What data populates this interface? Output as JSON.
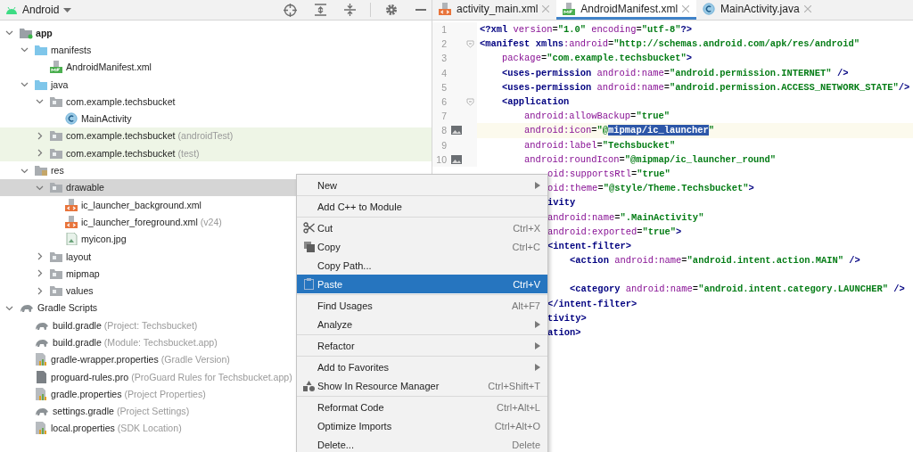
{
  "project_view": {
    "title": "Android"
  },
  "tree": [
    {
      "label": "app",
      "kind": "module",
      "expanded": true,
      "selected": false,
      "test_scope": false,
      "children": [
        {
          "label": "manifests",
          "kind": "folder",
          "expanded": true,
          "selected": false,
          "test_scope": false,
          "children": [
            {
              "label": "AndroidManifest.xml",
              "kind": "manifest",
              "selected": false,
              "test_scope": false
            }
          ]
        },
        {
          "label": "java",
          "kind": "folder",
          "expanded": true,
          "selected": false,
          "test_scope": false,
          "children": [
            {
              "label": "com.example.techsbucket",
              "kind": "package",
              "expanded": true,
              "selected": false,
              "test_scope": false,
              "children": [
                {
                  "label": "MainActivity",
                  "kind": "class",
                  "selected": false,
                  "test_scope": false
                }
              ]
            },
            {
              "label": "com.example.techsbucket",
              "note": "(androidTest)",
              "kind": "package",
              "expanded": false,
              "selected": false,
              "test_scope": true
            },
            {
              "label": "com.example.techsbucket",
              "note": "(test)",
              "kind": "package",
              "expanded": false,
              "selected": false,
              "test_scope": true
            }
          ]
        },
        {
          "label": "res",
          "kind": "res",
          "expanded": true,
          "selected": false,
          "test_scope": false,
          "children": [
            {
              "label": "drawable",
              "kind": "package",
              "expanded": true,
              "selected": true,
              "test_scope": false,
              "children": [
                {
                  "label": "ic_launcher_background.xml",
                  "kind": "xml",
                  "selected": false,
                  "test_scope": false
                },
                {
                  "label": "ic_launcher_foreground.xml",
                  "note": "(v24)",
                  "kind": "xml",
                  "selected": false,
                  "test_scope": false
                },
                {
                  "label": "myicon.jpg",
                  "kind": "image",
                  "selected": false,
                  "test_scope": false
                }
              ]
            },
            {
              "label": "layout",
              "kind": "package",
              "expanded": false,
              "selected": false,
              "test_scope": false
            },
            {
              "label": "mipmap",
              "kind": "package",
              "expanded": false,
              "selected": false,
              "test_scope": false
            },
            {
              "label": "values",
              "kind": "package",
              "expanded": false,
              "selected": false,
              "test_scope": false
            }
          ]
        }
      ]
    },
    {
      "label": "Gradle Scripts",
      "kind": "gradle",
      "expanded": true,
      "selected": false,
      "test_scope": false,
      "children": [
        {
          "label": "build.gradle",
          "note": "(Project: Techsbucket)",
          "kind": "gradle",
          "selected": false,
          "test_scope": false
        },
        {
          "label": "build.gradle",
          "note": "(Module: Techsbucket.app)",
          "kind": "gradle",
          "selected": false,
          "test_scope": false
        },
        {
          "label": "gradle-wrapper.properties",
          "note": "(Gradle Version)",
          "kind": "properties",
          "selected": false,
          "test_scope": false
        },
        {
          "label": "proguard-rules.pro",
          "note": "(ProGuard Rules for Techsbucket.app)",
          "kind": "proguard",
          "selected": false,
          "test_scope": false
        },
        {
          "label": "gradle.properties",
          "note": "(Project Properties)",
          "kind": "properties",
          "selected": false,
          "test_scope": false
        },
        {
          "label": "settings.gradle",
          "note": "(Project Settings)",
          "kind": "gradle",
          "selected": false,
          "test_scope": false
        },
        {
          "label": "local.properties",
          "note": "(SDK Location)",
          "kind": "properties",
          "selected": false,
          "test_scope": false
        }
      ]
    }
  ],
  "tabs": [
    {
      "label": "activity_main.xml",
      "kind": "xml",
      "selected": false
    },
    {
      "label": "AndroidManifest.xml",
      "kind": "manifest",
      "selected": true
    },
    {
      "label": "MainActivity.java",
      "kind": "class",
      "selected": false
    }
  ],
  "editor_lines": [
    {
      "kind": "code",
      "number": "1",
      "foldable": false,
      "preview": false,
      "current": false,
      "tokens": [
        {
          "kind": "tag",
          "text": "<?xml"
        },
        {
          "kind": "attr",
          "text": " version"
        },
        {
          "kind": "plain",
          "text": "="
        },
        {
          "kind": "value",
          "text": "\"1.0\""
        },
        {
          "kind": "attr",
          "text": " encoding"
        },
        {
          "kind": "plain",
          "text": "="
        },
        {
          "kind": "value",
          "text": "\"utf-8\""
        },
        {
          "kind": "tag",
          "text": "?>"
        }
      ]
    },
    {
      "kind": "code",
      "number": "2",
      "foldable": true,
      "preview": false,
      "current": false,
      "tokens": [
        {
          "kind": "tag",
          "text": "<manifest xmlns"
        },
        {
          "kind": "attr",
          "text": ":android"
        },
        {
          "kind": "plain",
          "text": "="
        },
        {
          "kind": "value",
          "text": "\"http://schemas.android.com/apk/res/android\""
        }
      ],
      "children": [
        {
          "kind": "code",
          "number": "3",
          "foldable": false,
          "preview": false,
          "current": false,
          "tokens": [
            {
              "kind": "attr",
              "text": "package"
            },
            {
              "kind": "plain",
              "text": "="
            },
            {
              "kind": "value",
              "text": "\"com.example.techsbucket\""
            },
            {
              "kind": "tag",
              "text": ">"
            }
          ]
        },
        {
          "kind": "code",
          "number": "4",
          "foldable": false,
          "preview": false,
          "current": false,
          "tokens": [
            {
              "kind": "tag",
              "text": "<uses-permission"
            },
            {
              "kind": "attr",
              "text": " android:name"
            },
            {
              "kind": "plain",
              "text": "="
            },
            {
              "kind": "value",
              "text": "\"android.permission.INTERNET\""
            },
            {
              "kind": "tag",
              "text": " />"
            }
          ]
        },
        {
          "kind": "code",
          "number": "5",
          "foldable": false,
          "preview": false,
          "current": false,
          "tokens": [
            {
              "kind": "tag",
              "text": "<uses-permission"
            },
            {
              "kind": "attr",
              "text": " android:name"
            },
            {
              "kind": "plain",
              "text": "="
            },
            {
              "kind": "value",
              "text": "\"android.permission.ACCESS_NETWORK_STATE\""
            },
            {
              "kind": "tag",
              "text": "/>"
            }
          ]
        },
        {
          "kind": "code",
          "number": "6",
          "foldable": true,
          "preview": false,
          "current": false,
          "tokens": [
            {
              "kind": "tag",
              "text": "<application"
            }
          ],
          "children": [
            {
              "kind": "code",
              "number": "7",
              "foldable": false,
              "preview": false,
              "current": false,
              "tokens": [
                {
                  "kind": "attr",
                  "text": "android:allowBackup"
                },
                {
                  "kind": "plain",
                  "text": "="
                },
                {
                  "kind": "value",
                  "text": "\"true\""
                }
              ]
            },
            {
              "kind": "code",
              "number": "8",
              "foldable": false,
              "preview": true,
              "current": true,
              "tokens": [
                {
                  "kind": "attr",
                  "text": "android:icon"
                },
                {
                  "kind": "plain",
                  "text": "="
                },
                {
                  "kind": "value",
                  "text": "\"@"
                },
                {
                  "kind": "selection",
                  "text": "mipmap/ic_launcher"
                },
                {
                  "kind": "value",
                  "text": "\""
                }
              ]
            },
            {
              "kind": "code",
              "number": "9",
              "foldable": false,
              "preview": false,
              "current": false,
              "tokens": [
                {
                  "kind": "attr",
                  "text": "android:label"
                },
                {
                  "kind": "plain",
                  "text": "="
                },
                {
                  "kind": "value",
                  "text": "\"Techsbucket\""
                }
              ]
            },
            {
              "kind": "code",
              "number": "10",
              "foldable": false,
              "preview": true,
              "current": false,
              "tokens": [
                {
                  "kind": "attr",
                  "text": "android:roundIcon"
                },
                {
                  "kind": "plain",
                  "text": "="
                },
                {
                  "kind": "value",
                  "text": "\"@mipmap/ic_launcher_round\""
                }
              ]
            }
          ]
        }
      ]
    }
  ],
  "clipped_lines": [
    {
      "kind": "code",
      "tokens": [
        {
          "kind": "attr",
          "text": "oid:supportsRtl"
        },
        {
          "kind": "plain",
          "text": "="
        },
        {
          "kind": "value",
          "text": "\"true\""
        }
      ]
    },
    {
      "kind": "code",
      "tokens": [
        {
          "kind": "attr",
          "text": "oid:theme"
        },
        {
          "kind": "plain",
          "text": "="
        },
        {
          "kind": "value",
          "text": "\"@style/Theme.Techsbucket\""
        },
        {
          "kind": "tag",
          "text": ">"
        }
      ]
    },
    {
      "kind": "code",
      "tokens": [
        {
          "kind": "tag",
          "text": "ivity"
        }
      ]
    },
    {
      "kind": "code",
      "tokens": [
        {
          "kind": "attr",
          "text": "android:name"
        },
        {
          "kind": "plain",
          "text": "="
        },
        {
          "kind": "value",
          "text": "\".MainActivity\""
        }
      ]
    },
    {
      "kind": "code",
      "tokens": [
        {
          "kind": "attr",
          "text": "android:exported"
        },
        {
          "kind": "plain",
          "text": "="
        },
        {
          "kind": "value",
          "text": "\"true\""
        },
        {
          "kind": "tag",
          "text": ">"
        }
      ]
    },
    {
      "kind": "code",
      "tokens": [
        {
          "kind": "tag",
          "text": "<intent-filter>"
        }
      ],
      "children": [
        {
          "kind": "code",
          "tokens": [
            {
              "kind": "tag",
              "text": "<action"
            },
            {
              "kind": "attr",
              "text": " android:name"
            },
            {
              "kind": "plain",
              "text": "="
            },
            {
              "kind": "value",
              "text": "\"android.intent.action.MAIN\""
            },
            {
              "kind": "tag",
              "text": " />"
            }
          ]
        },
        {
          "kind": "blank"
        },
        {
          "kind": "code",
          "tokens": [
            {
              "kind": "tag",
              "text": "<category"
            },
            {
              "kind": "attr",
              "text": " android:name"
            },
            {
              "kind": "plain",
              "text": "="
            },
            {
              "kind": "value",
              "text": "\"android.intent.category.LAUNCHER\""
            },
            {
              "kind": "tag",
              "text": " />"
            }
          ]
        }
      ]
    },
    {
      "kind": "code",
      "tokens": [
        {
          "kind": "tag",
          "text": "</intent-filter>"
        }
      ]
    },
    {
      "kind": "code",
      "tokens": [
        {
          "kind": "tag",
          "text": "tivity>"
        }
      ]
    },
    {
      "kind": "code",
      "tokens": [
        {
          "kind": "tag",
          "text": "ation>"
        }
      ]
    }
  ],
  "context_menu": {
    "groups": [
      [
        {
          "label": "New",
          "kind": "plain",
          "submenu": true,
          "selected": false
        }
      ],
      [
        {
          "label": "Add C++ to Module",
          "kind": "plain",
          "submenu": false,
          "selected": false
        }
      ],
      [
        {
          "label": "Cut",
          "kind": "scissors",
          "shortcut": "Ctrl+X",
          "submenu": false,
          "selected": false
        },
        {
          "label": "Copy",
          "kind": "copy",
          "shortcut": "Ctrl+C",
          "submenu": false,
          "selected": false
        },
        {
          "label": "Copy Path...",
          "kind": "plain",
          "submenu": false,
          "selected": false
        },
        {
          "label": "Paste",
          "kind": "clipboard",
          "shortcut": "Ctrl+V",
          "submenu": false,
          "selected": true
        }
      ],
      [
        {
          "label": "Find Usages",
          "kind": "plain",
          "shortcut": "Alt+F7",
          "submenu": false,
          "selected": false
        },
        {
          "label": "Analyze",
          "kind": "plain",
          "submenu": true,
          "selected": false
        }
      ],
      [
        {
          "label": "Refactor",
          "kind": "plain",
          "submenu": true,
          "selected": false
        }
      ],
      [
        {
          "label": "Add to Favorites",
          "kind": "plain",
          "submenu": true,
          "selected": false
        },
        {
          "label": "Show In Resource Manager",
          "kind": "resources",
          "shortcut": "Ctrl+Shift+T",
          "submenu": false,
          "selected": false
        }
      ],
      [
        {
          "label": "Reformat Code",
          "kind": "plain",
          "shortcut": "Ctrl+Alt+L",
          "submenu": false,
          "selected": false
        },
        {
          "label": "Optimize Imports",
          "kind": "plain",
          "shortcut": "Ctrl+Alt+O",
          "submenu": false,
          "selected": false
        },
        {
          "label": "Delete...",
          "kind": "plain",
          "shortcut": "Delete",
          "submenu": false,
          "selected": false
        }
      ]
    ]
  }
}
